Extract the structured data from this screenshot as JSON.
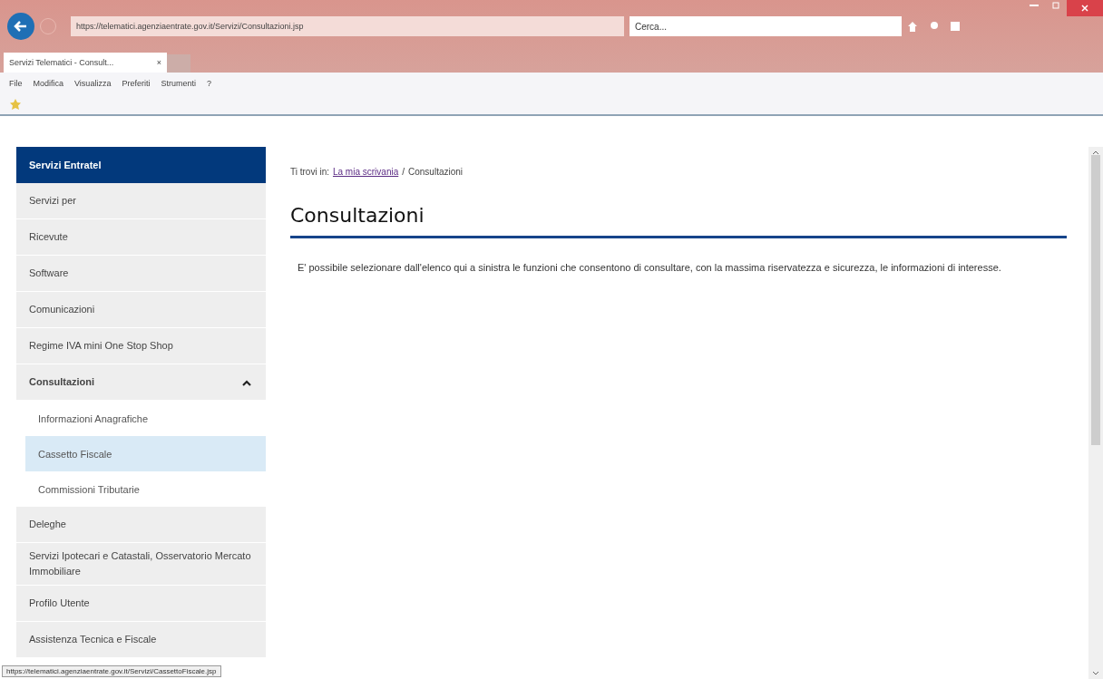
{
  "browser": {
    "url": "https://telematici.agenziaentrate.gov.it/Servizi/Consultazioni.jsp",
    "search": {
      "placeholder": "Cerca..."
    },
    "tab": {
      "title": "Servizi Telematici - Consult...",
      "close": "×"
    },
    "menu": [
      "File",
      "Modifica",
      "Visualizza",
      "Preferiti",
      "Strumenti",
      "?"
    ]
  },
  "sidebar": {
    "title": "Servizi Entratel",
    "items": [
      {
        "label": "Servizi per",
        "expanded": false
      },
      {
        "label": "Ricevute",
        "expanded": false
      },
      {
        "label": "Software",
        "expanded": false
      },
      {
        "label": "Comunicazioni",
        "expanded": false
      },
      {
        "label": "Regime IVA mini One Stop Shop",
        "expanded": false
      },
      {
        "label": "Consultazioni",
        "expanded": true,
        "children": [
          {
            "label": "Informazioni Anagrafiche",
            "selected": false
          },
          {
            "label": "Cassetto Fiscale",
            "selected": true
          },
          {
            "label": "Commissioni Tributarie",
            "selected": false
          }
        ]
      },
      {
        "label": "Deleghe",
        "expanded": false
      },
      {
        "label": "Servizi Ipotecari e Catastali, Osservatorio Mercato Immobiliare",
        "expanded": false
      },
      {
        "label": "Profilo Utente",
        "expanded": false
      },
      {
        "label": "Assistenza Tecnica e Fiscale",
        "expanded": false
      }
    ]
  },
  "breadcrumb": {
    "prefix": "Ti trovi in:",
    "link": "La mia scrivania",
    "separator": "/",
    "current": "Consultazioni"
  },
  "heading": "Consultazioni",
  "paragraph": "E' possibile selezionare dall'elenco qui a sinistra le funzioni che consentono di consultare, con la massima riservatezza e sicurezza, le informazioni di interesse.",
  "status_url": "https://telematici.agenziaentrate.gov.it/Servizi/CassettoFiscale.jsp"
}
